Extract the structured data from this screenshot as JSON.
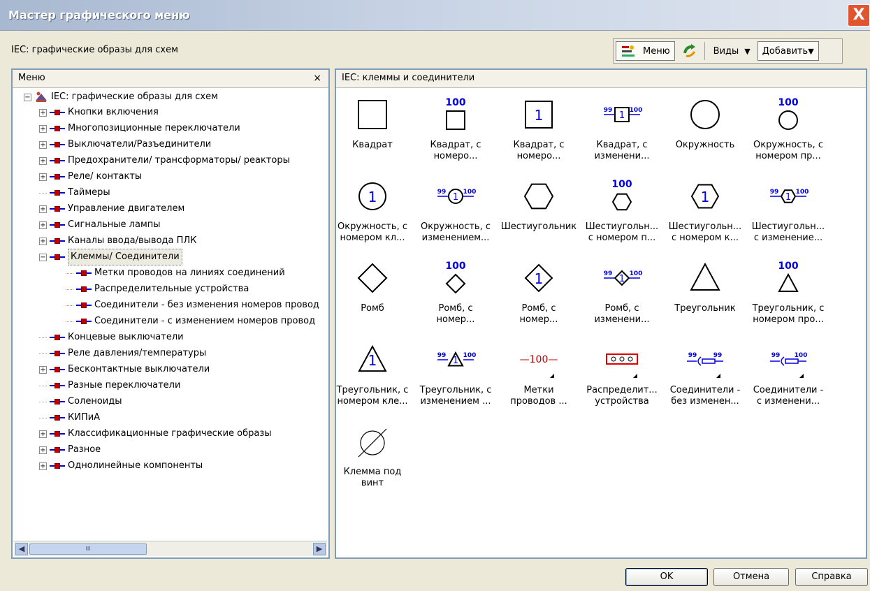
{
  "window": {
    "title": "Мастер графического меню",
    "close_glyph": "X"
  },
  "subtitle": "IEC: графические образы для схем",
  "toolbar": {
    "menu_label": "Меню",
    "views_label": "Виды",
    "add_label": "Добавить"
  },
  "left_panel": {
    "header": "Меню",
    "close": "×",
    "root": "IEC: графические образы для схем",
    "items": [
      {
        "label": "Кнопки включения",
        "expandable": true
      },
      {
        "label": "Многопозиционные переключатели",
        "expandable": true
      },
      {
        "label": "Выключатели/Разъединители",
        "expandable": true
      },
      {
        "label": "Предохранители/ трансформаторы/ реакторы",
        "expandable": true
      },
      {
        "label": "Реле/ контакты",
        "expandable": true
      },
      {
        "label": "Таймеры",
        "expandable": false
      },
      {
        "label": "Управление двигателем",
        "expandable": true
      },
      {
        "label": "Сигнальные лампы",
        "expandable": true
      },
      {
        "label": "Каналы ввода/вывода ПЛК",
        "expandable": true
      },
      {
        "label": "Клеммы/ Соединители",
        "expandable": true,
        "expanded": true,
        "selected": true
      },
      {
        "label": "Метки проводов на линиях соединений",
        "child": true
      },
      {
        "label": "Распределительные устройства",
        "child": true
      },
      {
        "label": "Соединители - без изменения номеров провод",
        "child": true
      },
      {
        "label": "Соединители - с изменением номеров провод",
        "child": true
      },
      {
        "label": "Концевые выключатели",
        "expandable": false
      },
      {
        "label": "Реле давления/температуры",
        "expandable": false
      },
      {
        "label": "Бесконтактные выключатели",
        "expandable": true
      },
      {
        "label": "Разные переключатели",
        "expandable": false
      },
      {
        "label": "Соленоиды",
        "expandable": false
      },
      {
        "label": "КИПиА",
        "expandable": false
      },
      {
        "label": "Классификационные графические образы",
        "expandable": true
      },
      {
        "label": "Разное",
        "expandable": true
      },
      {
        "label": "Однолинейные компоненты",
        "expandable": true
      }
    ]
  },
  "right_panel": {
    "header": "IEC: клеммы и соединители",
    "items": [
      {
        "icon": "square",
        "line1": "Квадрат",
        "line2": ""
      },
      {
        "icon": "square-num",
        "line1": "Квадрат, с",
        "line2": "номеро...",
        "num": "100"
      },
      {
        "icon": "square-in",
        "line1": "Квадрат, с",
        "line2": "номеро...",
        "num": "1"
      },
      {
        "icon": "square-change",
        "line1": "Квадрат, с",
        "line2": "изменени...",
        "num": "1",
        "left_num": "99",
        "right_num": "100"
      },
      {
        "icon": "circle",
        "line1": "Окружность",
        "line2": ""
      },
      {
        "icon": "circle-num",
        "line1": "Окружность, с",
        "line2": "номером пр...",
        "num": "100"
      },
      {
        "icon": "circle-in",
        "line1": "Окружность, с",
        "line2": "номером кл...",
        "num": "1"
      },
      {
        "icon": "circle-change",
        "line1": "Окружность, с",
        "line2": "изменением...",
        "num": "1",
        "left_num": "99",
        "right_num": "100"
      },
      {
        "icon": "hexagon",
        "line1": "Шестиугольник",
        "line2": ""
      },
      {
        "icon": "hexagon-num",
        "line1": "Шестиугольн...",
        "line2": "с номером п...",
        "num": "100"
      },
      {
        "icon": "hexagon-in",
        "line1": "Шестиугольн...",
        "line2": "с номером к...",
        "num": "1"
      },
      {
        "icon": "hexagon-change",
        "line1": "Шестиугольн...",
        "line2": "с изменение...",
        "num": "1",
        "left_num": "99",
        "right_num": "100"
      },
      {
        "icon": "rhomb",
        "line1": "Ромб",
        "line2": ""
      },
      {
        "icon": "rhomb-num",
        "line1": "Ромб, с",
        "line2": "номер...",
        "num": "100"
      },
      {
        "icon": "rhomb-in",
        "line1": "Ромб, с",
        "line2": "номер...",
        "num": "1"
      },
      {
        "icon": "rhomb-change",
        "line1": "Ромб, с",
        "line2": "изменени...",
        "num": "1",
        "left_num": "99",
        "right_num": "100"
      },
      {
        "icon": "triangle",
        "line1": "Треугольник",
        "line2": ""
      },
      {
        "icon": "triangle-num",
        "line1": "Треугольник, с",
        "line2": "номером про...",
        "num": "100"
      },
      {
        "icon": "triangle-in",
        "line1": "Треугольник, с",
        "line2": "номером кле...",
        "num": "1"
      },
      {
        "icon": "triangle-change",
        "line1": "Треугольник, с",
        "line2": "изменением ...",
        "num": "1",
        "left_num": "99",
        "right_num": "100"
      },
      {
        "icon": "wire-label",
        "line1": "Метки",
        "line2": "проводов ...",
        "num": "—100—"
      },
      {
        "icon": "distribution",
        "line1": "Распределит...",
        "line2": "устройства"
      },
      {
        "icon": "connector-same",
        "line1": "Соединители -",
        "line2": "без изменен...",
        "left_num": "99",
        "right_num": "99"
      },
      {
        "icon": "connector-change",
        "line1": "Соединители -",
        "line2": "с изменени...",
        "left_num": "99",
        "right_num": "100"
      },
      {
        "icon": "screw-terminal",
        "line1": "Клемма под",
        "line2": "винт"
      }
    ]
  },
  "buttons": {
    "ok": "OK",
    "cancel": "Отмена",
    "help": "Справка"
  }
}
